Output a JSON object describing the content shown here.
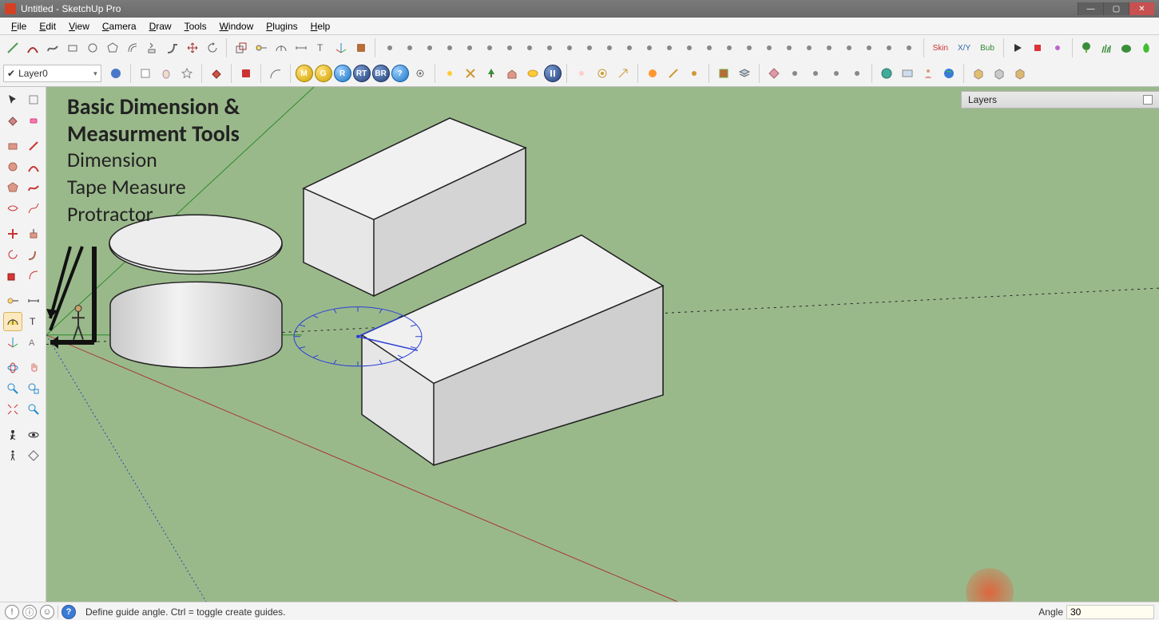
{
  "window": {
    "title": "Untitled - SketchUp Pro",
    "controls": {
      "min": "—",
      "max": "▢",
      "close": "✕"
    }
  },
  "menu": {
    "file": "File",
    "edit": "Edit",
    "view": "View",
    "camera": "Camera",
    "draw": "Draw",
    "tools": "Tools",
    "window": "Window",
    "plugins": "Plugins",
    "help": "Help"
  },
  "toolbar1": {
    "skin_label": "Skin",
    "xy_label": "X/Y",
    "bub_label": "Bub"
  },
  "toolbar2": {
    "layer_checked": "✔",
    "layer_name": "Layer0",
    "circles": [
      "M",
      "G",
      "R",
      "RT",
      "BR"
    ]
  },
  "layers_panel": {
    "title": "Layers"
  },
  "overlay": {
    "title_a": "Basic Dimension &",
    "title_b": "Measurment Tools",
    "line1": "Dimension",
    "line2": "Tape Measure",
    "line3": "Protractor"
  },
  "status": {
    "message": "Define guide angle.  Ctrl = toggle create guides.",
    "vcb_label": "Angle",
    "vcb_value": "30"
  },
  "icons": {
    "geoloc": "!",
    "user": "☺",
    "person": "👤",
    "help": "?"
  }
}
